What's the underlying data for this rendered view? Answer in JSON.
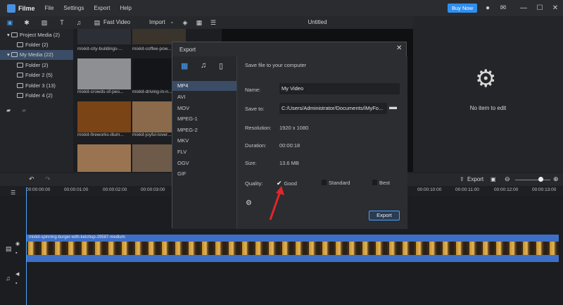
{
  "app": {
    "name": "Filme"
  },
  "menu": [
    "File",
    "Settings",
    "Export",
    "Help"
  ],
  "header": {
    "buy_now": "Buy Now"
  },
  "toolbar": {
    "fast_video": "Fast Video",
    "import": "Import"
  },
  "tree": {
    "items": [
      {
        "label": "Project Media (2)"
      },
      {
        "label": "Folder (2)"
      },
      {
        "label": "My Media (22)"
      },
      {
        "label": "Folder (2)"
      },
      {
        "label": "Folder 2 (5)"
      },
      {
        "label": "Folder 3 (13)"
      },
      {
        "label": "Folder 4 (2)"
      }
    ]
  },
  "media": {
    "items": [
      {
        "label": "mixkit-city-buildings-...",
        "color": "#2c2f36"
      },
      {
        "label": "mixkit-coffee-pow...",
        "color": "#3b342c"
      },
      {
        "label": "mixkit-crowds-of-peo...",
        "color": "#8d8f93"
      },
      {
        "label": "mixkit-driving-in-n...",
        "color": "#141518"
      },
      {
        "label": "mixkit-fireworks-illum...",
        "color": "#7a4417"
      },
      {
        "label": "mixkit-joyful-lover...",
        "color": "#8a6a4a"
      },
      {
        "label": "",
        "color": "#9a7450"
      },
      {
        "label": "",
        "color": "#6e5a48"
      }
    ]
  },
  "preview": {
    "title": "Untitled"
  },
  "right_panel": {
    "empty_text": "No item to edit"
  },
  "timeline": {
    "export_label": "Export",
    "ticks": [
      "00:00:00:00",
      "00:00:01:00",
      "00:00:02:00",
      "00:00:03:00",
      "00:00:10:00",
      "00:00:11:00",
      "00:00:12:00",
      "00:00:13:00"
    ],
    "clip_label": "mixkit-spinning-burger-with-ketchup-29587-medium"
  },
  "dialog": {
    "title": "Export",
    "formats": [
      "MP4",
      "AVI",
      "MOV",
      "MPEG-1",
      "MPEG-2",
      "MKV",
      "FLV",
      "OGV",
      "GIF"
    ],
    "save_heading": "Save file to your computer",
    "name_label": "Name:",
    "name_value": "My Video",
    "save_to_label": "Save to:",
    "save_to_value": "C:/Users/Administrator/Documents/iMyFo...",
    "resolution_label": "Resolution:",
    "resolution_value": "1920 x 1080",
    "duration_label": "Duration:",
    "duration_value": "00:00:18",
    "size_label": "Size:",
    "size_value": "13.6 MB",
    "quality_label": "Quality:",
    "quality_good": "Good",
    "quality_standard": "Standard",
    "quality_best": "Best",
    "export_button": "Export"
  },
  "colors": {
    "accent": "#2f8ff0",
    "selection": "#3b4d66",
    "track": "#3e6fc6",
    "arrow": "#e0262a"
  }
}
